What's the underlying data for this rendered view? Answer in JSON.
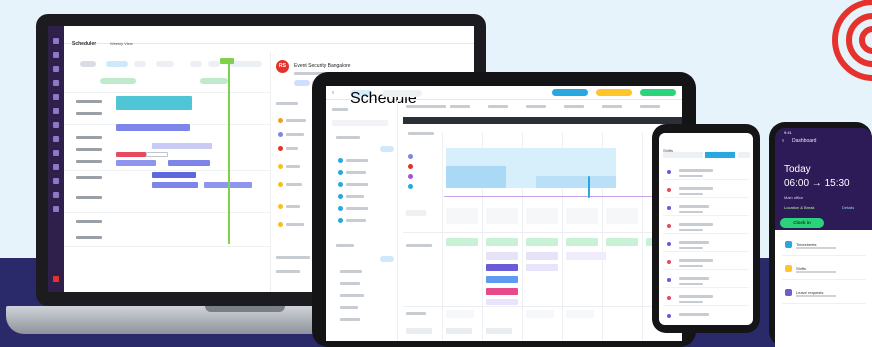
{
  "laptop": {
    "app_title": "Scheduler",
    "view_label": "Weekly View",
    "panel_title": "Event Security Bangalore",
    "avatar_initials": "RS"
  },
  "tablet": {
    "app_label": "Schedule"
  },
  "phone_small": {
    "title": "Shifts"
  },
  "phone_large": {
    "header": "Dashboard",
    "today_label": "Today",
    "time_range": "06:00 → 15:30",
    "location": "Main office",
    "sublink": "Location & Break",
    "link": "Details",
    "clock_in_button": "Clock in",
    "list_items": [
      "Timesheets",
      "Shifts",
      "Leave requests"
    ]
  },
  "colors": {
    "brand_red": "#e5322d",
    "dark_band": "#2a2a6a",
    "accent_green": "#2bd37a",
    "accent_blue": "#27a8e0",
    "accent_purple": "#6a5bd6"
  }
}
